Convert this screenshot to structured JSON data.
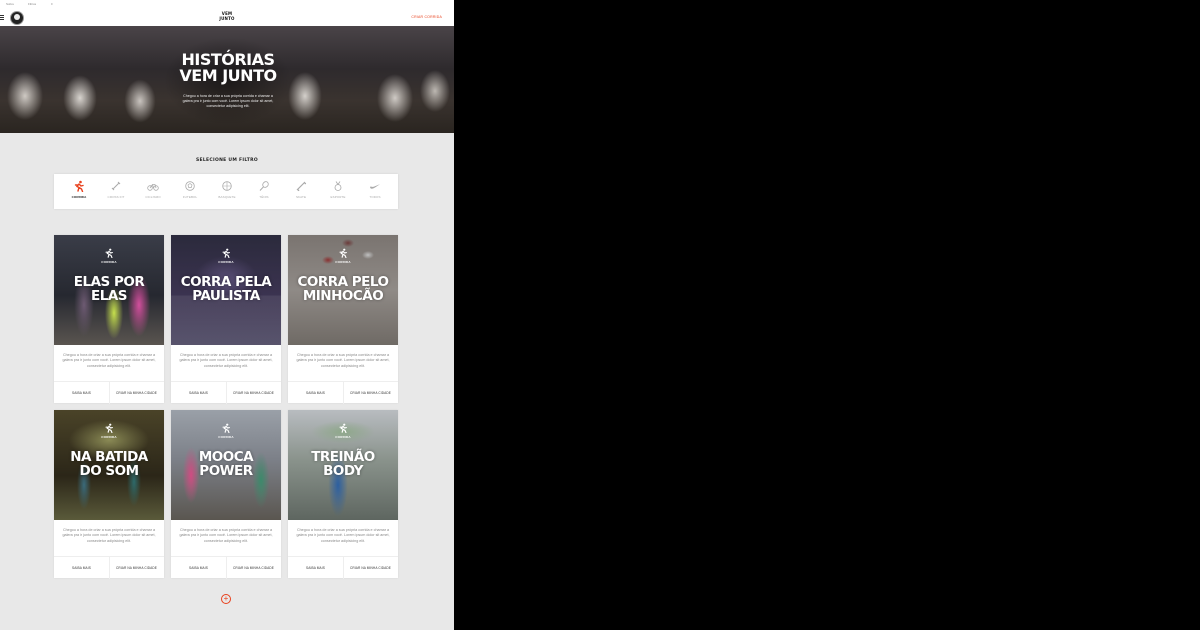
{
  "topbar": {
    "items": [
      "Sobre",
      "Filtros",
      "≡"
    ]
  },
  "header": {
    "brand_line1": "VEM",
    "brand_line2": "JUNTO",
    "create_link": "CRIAR CORRIDA"
  },
  "hero": {
    "title_line1": "HISTÓRIAS",
    "title_line2": "VEM JUNTO",
    "description": "Chegou a hora de criar a sua própria corrida e chamar a galera pra ir junto com você. Lorem ipsum dolor sit amet, consectetur adipisicing elit."
  },
  "filters": {
    "heading": "SELECIONE UM FILTRO",
    "items": [
      {
        "label": "CORRIDA",
        "icon": "runner-icon",
        "active": true
      },
      {
        "label": "CROSS FIT",
        "icon": "crossfit-icon",
        "active": false
      },
      {
        "label": "CICLISMO",
        "icon": "bicycle-icon",
        "active": false
      },
      {
        "label": "FUTEBOL",
        "icon": "soccer-ball-icon",
        "active": false
      },
      {
        "label": "BASQUETE",
        "icon": "basketball-icon",
        "active": false
      },
      {
        "label": "TÊNIS",
        "icon": "tennis-racket-icon",
        "active": false
      },
      {
        "label": "SKATE",
        "icon": "skateboard-icon",
        "active": false
      },
      {
        "label": "ESPORTE",
        "icon": "medal-icon",
        "active": false
      },
      {
        "label": "TODOS",
        "icon": "swoosh-icon",
        "active": false
      }
    ]
  },
  "cards": [
    {
      "category": "CORRIDA",
      "title_line1": "ELAS POR",
      "title_line2": "ELAS",
      "description": "Chegou a hora de criar a sua própria corrida e chamar a galera pra ir junto com você. Lorem ipsum dolor sit amet, consectetur adipisicing elit.",
      "more": "SAIBA MAIS",
      "create": "CRIAR NA MINHA CIDADE"
    },
    {
      "category": "CORRIDA",
      "title_line1": "CORRA PELA",
      "title_line2": "PAULISTA",
      "description": "Chegou a hora de criar a sua própria corrida e chamar a galera pra ir junto com você. Lorem ipsum dolor sit amet, consectetur adipisicing elit.",
      "more": "SAIBA MAIS",
      "create": "CRIAR NA MINHA CIDADE"
    },
    {
      "category": "CORRIDA",
      "title_line1": "CORRA PELO",
      "title_line2": "MINHOCÃO",
      "description": "Chegou a hora de criar a sua própria corrida e chamar a galera pra ir junto com você. Lorem ipsum dolor sit amet, consectetur adipisicing elit.",
      "more": "SAIBA MAIS",
      "create": "CRIAR NA MINHA CIDADE"
    },
    {
      "category": "CORRIDA",
      "title_line1": "NA BATIDA",
      "title_line2": "DO SOM",
      "description": "Chegou a hora de criar a sua própria corrida e chamar a galera pra ir junto com você. Lorem ipsum dolor sit amet, consectetur adipisicing elit.",
      "more": "SAIBA MAIS",
      "create": "CRIAR NA MINHA CIDADE"
    },
    {
      "category": "CORRIDA",
      "title_line1": "MOOCA",
      "title_line2": "POWER",
      "description": "Chegou a hora de criar a sua própria corrida e chamar a galera pra ir junto com você. Lorem ipsum dolor sit amet, consectetur adipisicing elit.",
      "more": "SAIBA MAIS",
      "create": "CRIAR NA MINHA CIDADE"
    },
    {
      "category": "CORRIDA",
      "title_line1": "TREINÃO",
      "title_line2": "BODY",
      "description": "Chegou a hora de criar a sua própria corrida e chamar a galera pra ir junto com você. Lorem ipsum dolor sit amet, consectetur adipisicing elit.",
      "more": "SAIBA MAIS",
      "create": "CRIAR NA MINHA CIDADE"
    }
  ],
  "load_more": {
    "label": "+"
  },
  "colors": {
    "accent": "#e8401c",
    "background": "#e8e8e8",
    "card": "#ffffff"
  }
}
